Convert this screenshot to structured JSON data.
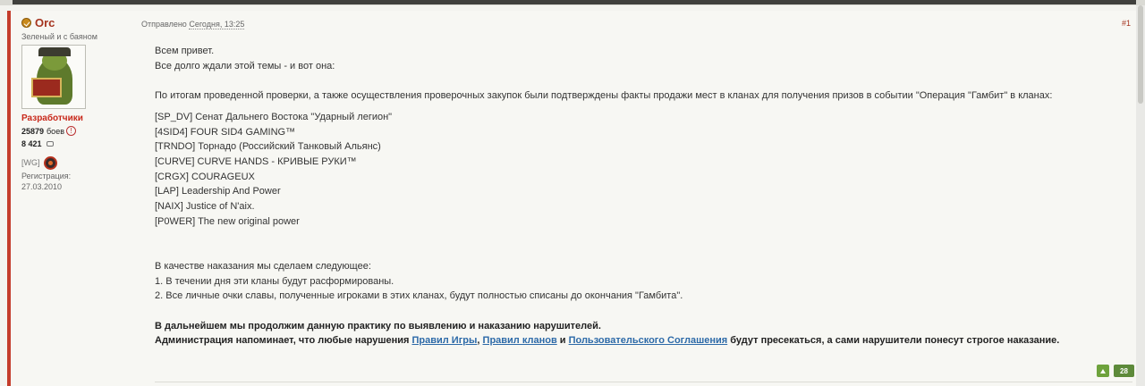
{
  "author": {
    "name": "Orc",
    "title": "Зеленый и с баяном",
    "group": "Разработчики",
    "battles_value": "25879",
    "battles_label": "боев",
    "messages": "8 421",
    "clan_tag": "[WG]",
    "reg_label": "Регистрация:",
    "reg_date": "27.03.2010",
    "icons": [
      "online-status-icon",
      "info-icon",
      "speech-icon",
      "clan-emblem-icon"
    ]
  },
  "post": {
    "sent_label": "Отправлено",
    "date": "Сегодня, 13:25",
    "number": "#1",
    "lines": {
      "greet": "Всем привет.",
      "wait": "Все долго ждали этой темы - и вот она:",
      "intro": "По итогам проведенной проверки, а также осуществления проверочных закупок были подтверждены факты продажи мест в кланах для получения призов в событии \"Операция \"Гамбит\" в кланах:",
      "punish_intro": "В качестве наказания мы сделаем следующее:",
      "punish_1": "1. В течении дня эти кланы будут расформированы.",
      "punish_2": "2. Все личные очки славы, полученные игроками в этих кланах, будут полностью списаны до окончания \"Гамбита\".",
      "bold_1": "В дальнейшем мы продолжим данную практику по выявлению и наказанию нарушителей.",
      "bold_2_a": "Администрация напоминает, что любые нарушения ",
      "link_game_rules": "Правил Игры",
      "comma": ", ",
      "link_clan_rules": "Правил кланов",
      "and": " и ",
      "link_user_agreement": "Пользовательского Соглашения",
      "bold_2_b": " будут пресекаться, а сами нарушители понесут строгое наказание."
    },
    "clans": [
      "[SP_DV] Сенат Дальнего Востока \"Ударный легион\"",
      "[4SID4] FOUR SID4 GAMING™",
      "[TRNDO] Торнадо (Российский Танковый Альянс)",
      "[CURVE] CURVE HANDS - КРИВЫЕ РУКИ™",
      "[CRGX] COURAGEUX",
      "[LAP] Leadership And Power",
      "[NAIX] Justice of N'aix.",
      "[P0WER] The new original power"
    ],
    "reputation": "28"
  },
  "colors": {
    "accent": "#a5341f",
    "group": "#c8281a",
    "link": "#2d6aa8",
    "rep": "#5d8a3a"
  }
}
